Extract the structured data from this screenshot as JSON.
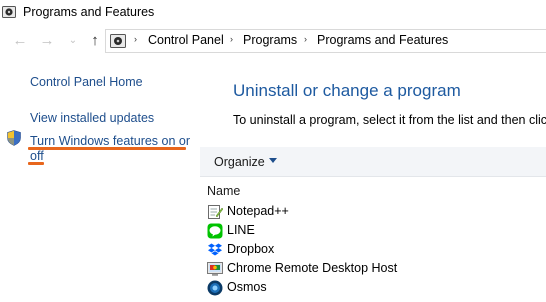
{
  "window": {
    "title": "Programs and Features"
  },
  "nav": {
    "back_glyph": "←",
    "forward_glyph": "→",
    "recent_glyph": "⌄",
    "up_glyph": "↑",
    "separator_glyph": "›",
    "breadcrumbs": [
      "Control Panel",
      "Programs",
      "Programs and Features"
    ]
  },
  "sidebar": {
    "home": "Control Panel Home",
    "updates": "View installed updates",
    "features_line1": "Turn Windows features on or",
    "features_line2": "off"
  },
  "main": {
    "heading": "Uninstall or change a program",
    "description": "To uninstall a program, select it from the list and then click",
    "toolbar": {
      "organize_label": "Organize"
    },
    "column_name": "Name",
    "programs": [
      {
        "name": "Notepad++",
        "icon": "notepad-plus-plus-icon"
      },
      {
        "name": "LINE",
        "icon": "line-icon"
      },
      {
        "name": "Dropbox",
        "icon": "dropbox-icon"
      },
      {
        "name": "Chrome Remote Desktop Host",
        "icon": "chrome-remote-desktop-icon"
      },
      {
        "name": "Osmos",
        "icon": "osmos-icon"
      }
    ]
  },
  "colors": {
    "link": "#1e4e8c",
    "heading": "#1e5aa0",
    "highlight_underline": "#e8661c",
    "toolbar_bg": "#f3f5f8"
  }
}
